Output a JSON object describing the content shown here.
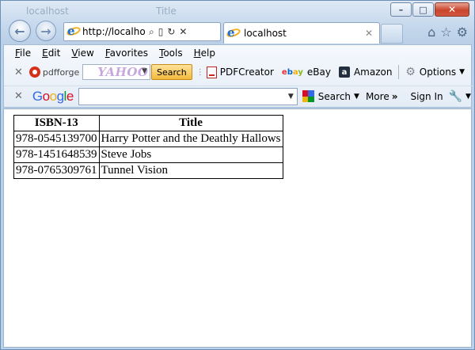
{
  "window": {
    "ghost_titles": [
      "localhost",
      "Title"
    ],
    "controls": {
      "minimize": "–",
      "maximize": "□",
      "close": "✕"
    }
  },
  "nav": {
    "back_icon": "back-arrow-icon",
    "forward_icon": "forward-arrow-icon"
  },
  "address": {
    "url": "http://localhost:",
    "icons": [
      "search-icon",
      "compatibility-icon",
      "refresh-icon",
      "stop-icon"
    ]
  },
  "tab": {
    "title": "localhost",
    "close": "✕"
  },
  "right_icons": [
    "home-icon",
    "favorites-star-icon",
    "tools-gear-icon"
  ],
  "menu": {
    "items": [
      {
        "label": "File",
        "key": "F",
        "rest": "ile"
      },
      {
        "label": "Edit",
        "key": "E",
        "rest": "dit"
      },
      {
        "label": "View",
        "key": "V",
        "rest": "iew"
      },
      {
        "label": "Favorites",
        "key": "F",
        "rest": "avorites"
      },
      {
        "label": "Tools",
        "key": "T",
        "rest": "ools"
      },
      {
        "label": "Help",
        "key": "H",
        "rest": "elp"
      }
    ]
  },
  "toolbar1": {
    "close": "✕",
    "pdfforge_label": "pdfforge",
    "yahoo_label": "YAHOO!",
    "search_button": "Search",
    "pdfcreator": "PDFCreator",
    "ebay": "eBay",
    "amazon": "Amazon",
    "options": "Options"
  },
  "toolbar2": {
    "close": "✕",
    "google": "Google",
    "search": "Search",
    "more": "More",
    "more_glyph": "»",
    "signin": "Sign In"
  },
  "table": {
    "headers": [
      "ISBN-13",
      "Title"
    ],
    "rows": [
      [
        "978-0545139700",
        "Harry Potter and the Deathly Hallows"
      ],
      [
        "978-1451648539",
        "Steve Jobs"
      ],
      [
        "978-0765309761",
        "Tunnel Vision"
      ]
    ]
  },
  "colors": {
    "chrome": "#b9d1ea",
    "close_button": "#c8452c",
    "yahoo_search": "#f5b93c"
  }
}
